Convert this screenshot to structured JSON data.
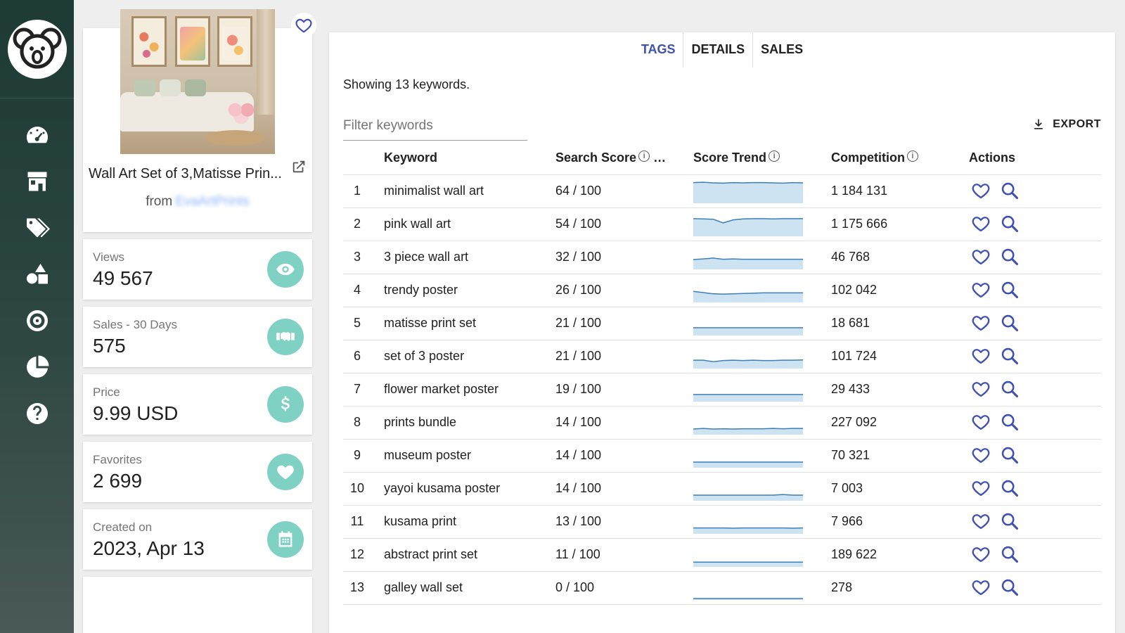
{
  "sidebar": {
    "logo_icon": "koala-logo-icon",
    "items": [
      {
        "icon": "dashboard-gauge-icon"
      },
      {
        "icon": "shop-store-icon"
      },
      {
        "icon": "tags-icon"
      },
      {
        "icon": "shapes-icon"
      },
      {
        "icon": "target-icon"
      },
      {
        "icon": "pie-chart-icon"
      },
      {
        "icon": "help-icon"
      }
    ]
  },
  "product": {
    "title": "Wall Art Set of 3,Matisse Prin...",
    "from_label": "from",
    "shop_name": "EvaArtPrints"
  },
  "stats": [
    {
      "label": "Views",
      "value": "49 567",
      "icon": "eye-icon"
    },
    {
      "label": "Sales - 30 Days",
      "value": "575",
      "icon": "handshake-icon"
    },
    {
      "label": "Price",
      "value": "9.99 USD",
      "icon": "dollar-icon"
    },
    {
      "label": "Favorites",
      "value": "2 699",
      "icon": "heart-icon"
    },
    {
      "label": "Created on",
      "value": "2023, Apr 13",
      "icon": "calendar-icon"
    }
  ],
  "tabs": [
    {
      "label": "TAGS",
      "active": true
    },
    {
      "label": "DETAILS",
      "active": false
    },
    {
      "label": "SALES",
      "active": false
    }
  ],
  "showing_text": "Showing 13 keywords.",
  "filter": {
    "placeholder": "Filter keywords",
    "value": ""
  },
  "export_label": "EXPORT",
  "table": {
    "headers": {
      "keyword": "Keyword",
      "search_score": "Search Score",
      "score_trend": "Score Trend",
      "competition": "Competition",
      "actions": "Actions"
    },
    "rows": [
      {
        "num": "1",
        "keyword": "minimalist wall art",
        "score": "64 / 100",
        "competition": "1 184 131",
        "trend": [
          64,
          65,
          63,
          62,
          64,
          63,
          64,
          64,
          63,
          62,
          64,
          63
        ]
      },
      {
        "num": "2",
        "keyword": "pink wall art",
        "score": "54 / 100",
        "competition": "1 175 666",
        "trend": [
          54,
          53,
          52,
          40,
          50,
          53,
          54,
          54,
          53,
          54,
          54,
          54
        ]
      },
      {
        "num": "3",
        "keyword": "3 piece wall art",
        "score": "32 / 100",
        "competition": "46 768",
        "trend": [
          28,
          30,
          33,
          29,
          30,
          29,
          29,
          29,
          29,
          29,
          29,
          29
        ]
      },
      {
        "num": "4",
        "keyword": "trendy poster",
        "score": "26 / 100",
        "competition": "102 042",
        "trend": [
          32,
          28,
          24,
          23,
          24,
          25,
          26,
          27,
          27,
          27,
          27,
          27
        ]
      },
      {
        "num": "5",
        "keyword": "matisse print set",
        "score": "21 / 100",
        "competition": "18 681",
        "trend": [
          21,
          21,
          21,
          21,
          21,
          21,
          21,
          21,
          21,
          21,
          21,
          21
        ]
      },
      {
        "num": "6",
        "keyword": "set of 3 poster",
        "score": "21 / 100",
        "competition": "101 724",
        "trend": [
          23,
          23,
          18,
          22,
          23,
          22,
          23,
          22,
          22,
          23,
          23,
          24
        ]
      },
      {
        "num": "7",
        "keyword": "flower market poster",
        "score": "19 / 100",
        "competition": "29 433",
        "trend": [
          19,
          19,
          19,
          19,
          19,
          19,
          19,
          19,
          19,
          19,
          19,
          19
        ]
      },
      {
        "num": "8",
        "keyword": "prints bundle",
        "score": "14 / 100",
        "competition": "227 092",
        "trend": [
          14,
          16,
          14,
          15,
          14,
          15,
          15,
          15,
          16,
          15,
          16,
          16
        ]
      },
      {
        "num": "9",
        "keyword": "museum poster",
        "score": "14 / 100",
        "competition": "70 321",
        "trend": [
          14,
          14,
          14,
          14,
          14,
          14,
          14,
          14,
          14,
          14,
          14,
          14
        ]
      },
      {
        "num": "10",
        "keyword": "yayoi kusama poster",
        "score": "14 / 100",
        "competition": "7 003",
        "trend": [
          14,
          14,
          14,
          14,
          14,
          14,
          14,
          14,
          14,
          16,
          14,
          14
        ]
      },
      {
        "num": "11",
        "keyword": "kusama print",
        "score": "13 / 100",
        "competition": "7 966",
        "trend": [
          15,
          15,
          15,
          15,
          14,
          15,
          15,
          15,
          15,
          15,
          14,
          15
        ]
      },
      {
        "num": "12",
        "keyword": "abstract print set",
        "score": "11 / 100",
        "competition": "189 622",
        "trend": [
          11,
          11,
          11,
          11,
          11,
          11,
          11,
          11,
          11,
          11,
          11,
          11
        ]
      },
      {
        "num": "13",
        "keyword": "galley wall set",
        "score": "0 / 100",
        "competition": "278",
        "trend": [
          0,
          0,
          0,
          0,
          0,
          0,
          0,
          0,
          0,
          0,
          0,
          0
        ]
      }
    ]
  },
  "colors": {
    "accent": "#3f51b5",
    "teal": "#7fd1c3",
    "trend_line": "#3d7fb8",
    "trend_fill": "#cde3f2"
  }
}
